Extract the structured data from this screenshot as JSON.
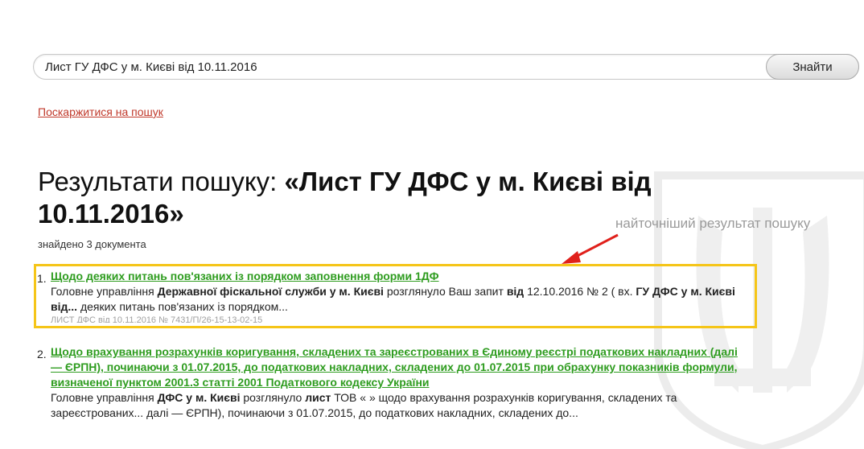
{
  "search": {
    "query": "Лист ГУ ДФС у м. Києві від 10.11.2016",
    "button_label": "Знайти"
  },
  "complain_link": "Поскаржитися на пошук",
  "results_header": {
    "prefix": "Результати пошуку: ",
    "query_quoted": "«Лист ГУ ДФС у м. Києві від 10.11.2016»"
  },
  "found_count": "знайдено 3 документа",
  "annotation": {
    "text": "найточніший результат пошуку",
    "arrow_color": "#e0201b",
    "highlight_color": "#f5c518"
  },
  "results": [
    {
      "number": "1.",
      "title": "Щодо деяких питань пов'язаних із порядком заповнення форми 1ДФ",
      "snippet": [
        {
          "t": "Головне управління ",
          "b": false
        },
        {
          "t": "Державної фіскальної служби у м. Києві",
          "b": true
        },
        {
          "t": " розглянуло Ваш запит ",
          "b": false
        },
        {
          "t": "від",
          "b": true
        },
        {
          "t": " 12.10.2016 № 2 ( вх. ",
          "b": false
        },
        {
          "t": "ГУ ДФС у м. Києві від...",
          "b": true
        },
        {
          "t": " деяких питань пов'язаних із порядком...",
          "b": false
        }
      ],
      "meta": "ЛИСТ ДФС від 10.11.2016 № 7431/П/26-15-13-02-15"
    },
    {
      "number": "2.",
      "title": "Щодо врахування розрахунків коригування, складених та зареєстрованих в Єдиному реєстрі податкових накладних (далі — ЄРПН), починаючи з 01.07.2015, до податкових накладних, складених до 01.07.2015 при обрахунку показників формули, визначеної пунктом 2001.3 статті 2001 Податкового кодексу України",
      "snippet": [
        {
          "t": "Головне управління ",
          "b": false
        },
        {
          "t": "ДФС у м. Києві",
          "b": true
        },
        {
          "t": " розглянуло ",
          "b": false
        },
        {
          "t": "лист",
          "b": true
        },
        {
          "t": " ТОВ « » щодо врахування розрахунків коригування, складених та зареєстрованих... далі — ЄРПН), починаючи з 01.07.2015, до податкових накладних, складених до...",
          "b": false
        }
      ],
      "meta": ""
    }
  ]
}
